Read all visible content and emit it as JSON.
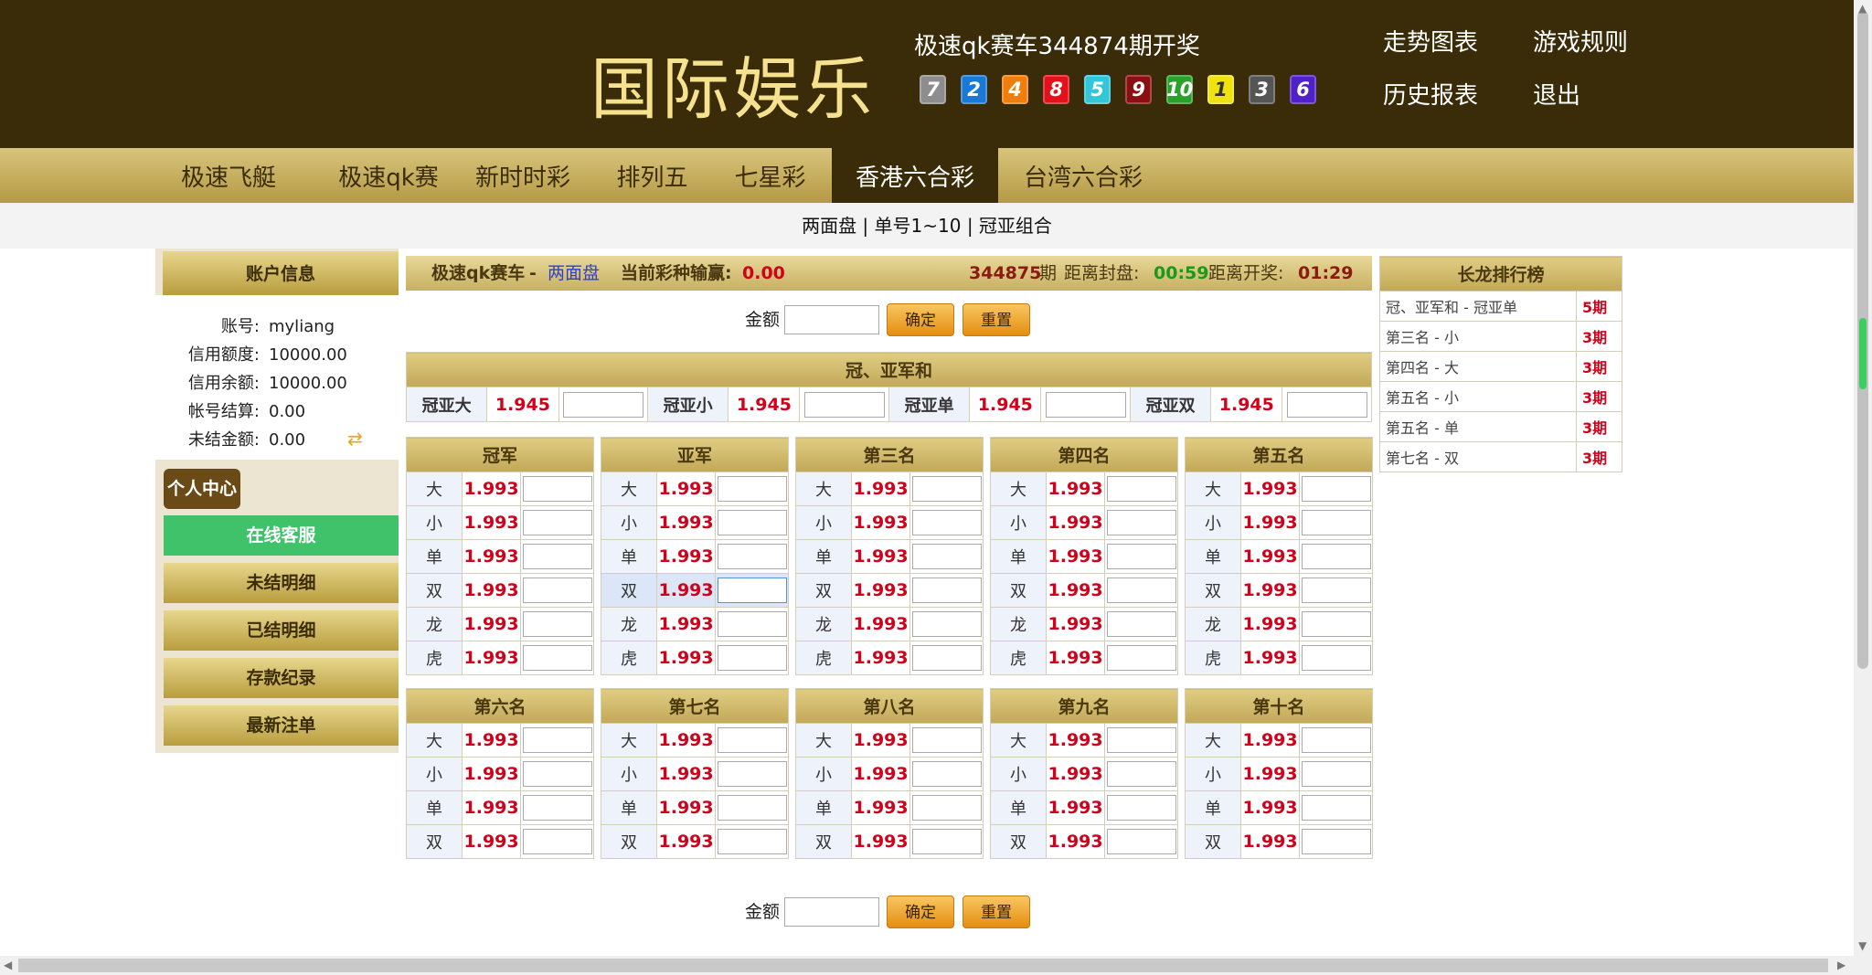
{
  "header": {
    "logo": "国际娱乐",
    "draw_title": "极速qk赛车344874期开奖",
    "balls": [
      {
        "n": "7",
        "color": "#8d8d8d"
      },
      {
        "n": "2",
        "color": "#1a78d6"
      },
      {
        "n": "4",
        "color": "#f07e0d"
      },
      {
        "n": "8",
        "color": "#e4111a"
      },
      {
        "n": "5",
        "color": "#31c6d8"
      },
      {
        "n": "9",
        "color": "#8b0f12"
      },
      {
        "n": "10",
        "color": "#2aa12a"
      },
      {
        "n": "1",
        "color": "#f0e20e"
      },
      {
        "n": "3",
        "color": "#555555"
      },
      {
        "n": "6",
        "color": "#5020c9"
      }
    ],
    "links": {
      "trend": "走势图表",
      "rules": "游戏规则",
      "history": "历史报表",
      "logout": "退出"
    }
  },
  "nav": {
    "tabs": [
      "极速飞艇",
      "极速qk赛",
      "新时时彩",
      "排列五",
      "七星彩",
      "香港六合彩",
      "台湾六合彩"
    ],
    "active": "香港六合彩"
  },
  "subnav": {
    "items": [
      "两面盘",
      "单号1~10",
      "冠亚组合"
    ],
    "sep": " | "
  },
  "account": {
    "title": "账户信息",
    "rows": [
      {
        "label": "账号:",
        "value": "myliang"
      },
      {
        "label": "信用额度:",
        "value": "10000.00"
      },
      {
        "label": "信用余额:",
        "value": "10000.00"
      },
      {
        "label": "帐号结算:",
        "value": "0.00"
      },
      {
        "label": "未结金额:",
        "value": "0.00"
      }
    ]
  },
  "menu": {
    "personal": "个人中心",
    "service": "在线客服",
    "unsettled": "未结明细",
    "settled": "已结明细",
    "deposit": "存款纪录",
    "latest": "最新注单"
  },
  "infobar": {
    "game": "极速qk赛车",
    "dash": "-",
    "mode": "两面盘",
    "winloss_label": "当前彩种输赢:",
    "winloss": "0.00",
    "period": "344875",
    "period_unit": "期",
    "close_label": "距离封盘:",
    "close_time": "00:59",
    "open_label": "距离开奖:",
    "open_time": "01:29"
  },
  "amount": {
    "label": "金额",
    "bottom_label": "金额",
    "confirm": "确定",
    "reset": "重置"
  },
  "champion_sum": {
    "title": "冠、亚军和",
    "items": [
      {
        "label": "冠亚大",
        "odds": "1.945"
      },
      {
        "label": "冠亚小",
        "odds": "1.945"
      },
      {
        "label": "冠亚单",
        "odds": "1.945"
      },
      {
        "label": "冠亚双",
        "odds": "1.945"
      }
    ]
  },
  "positions_top": [
    {
      "title": "冠军",
      "rows": [
        [
          "大",
          "1.993"
        ],
        [
          "小",
          "1.993"
        ],
        [
          "单",
          "1.993"
        ],
        [
          "双",
          "1.993"
        ],
        [
          "龙",
          "1.993"
        ],
        [
          "虎",
          "1.993"
        ]
      ]
    },
    {
      "title": "亚军",
      "rows": [
        [
          "大",
          "1.993"
        ],
        [
          "小",
          "1.993"
        ],
        [
          "单",
          "1.993"
        ],
        [
          "双",
          "1.993"
        ],
        [
          "龙",
          "1.993"
        ],
        [
          "虎",
          "1.993"
        ]
      ]
    },
    {
      "title": "第三名",
      "rows": [
        [
          "大",
          "1.993"
        ],
        [
          "小",
          "1.993"
        ],
        [
          "单",
          "1.993"
        ],
        [
          "双",
          "1.993"
        ],
        [
          "龙",
          "1.993"
        ],
        [
          "虎",
          "1.993"
        ]
      ]
    },
    {
      "title": "第四名",
      "rows": [
        [
          "大",
          "1.993"
        ],
        [
          "小",
          "1.993"
        ],
        [
          "单",
          "1.993"
        ],
        [
          "双",
          "1.993"
        ],
        [
          "龙",
          "1.993"
        ],
        [
          "虎",
          "1.993"
        ]
      ]
    },
    {
      "title": "第五名",
      "rows": [
        [
          "大",
          "1.993"
        ],
        [
          "小",
          "1.993"
        ],
        [
          "单",
          "1.993"
        ],
        [
          "双",
          "1.993"
        ],
        [
          "龙",
          "1.993"
        ],
        [
          "虎",
          "1.993"
        ]
      ]
    }
  ],
  "positions_bottom": [
    {
      "title": "第六名",
      "rows": [
        [
          "大",
          "1.993"
        ],
        [
          "小",
          "1.993"
        ],
        [
          "单",
          "1.993"
        ],
        [
          "双",
          "1.993"
        ]
      ]
    },
    {
      "title": "第七名",
      "rows": [
        [
          "大",
          "1.993"
        ],
        [
          "小",
          "1.993"
        ],
        [
          "单",
          "1.993"
        ],
        [
          "双",
          "1.993"
        ]
      ]
    },
    {
      "title": "第八名",
      "rows": [
        [
          "大",
          "1.993"
        ],
        [
          "小",
          "1.993"
        ],
        [
          "单",
          "1.993"
        ],
        [
          "双",
          "1.993"
        ]
      ]
    },
    {
      "title": "第九名",
      "rows": [
        [
          "大",
          "1.993"
        ],
        [
          "小",
          "1.993"
        ],
        [
          "单",
          "1.993"
        ],
        [
          "双",
          "1.993"
        ]
      ]
    },
    {
      "title": "第十名",
      "rows": [
        [
          "大",
          "1.993"
        ],
        [
          "小",
          "1.993"
        ],
        [
          "单",
          "1.993"
        ],
        [
          "双",
          "1.993"
        ]
      ]
    }
  ],
  "ranking": {
    "title": "长龙排行榜",
    "rows": [
      {
        "label": "冠、亚军和 - 冠亚单",
        "value": "5期"
      },
      {
        "label": "第三名 - 小",
        "value": "3期"
      },
      {
        "label": "第四名 - 大",
        "value": "3期"
      },
      {
        "label": "第五名 - 小",
        "value": "3期"
      },
      {
        "label": "第五名 - 单",
        "value": "3期"
      },
      {
        "label": "第七名 - 双",
        "value": "3期"
      }
    ]
  }
}
